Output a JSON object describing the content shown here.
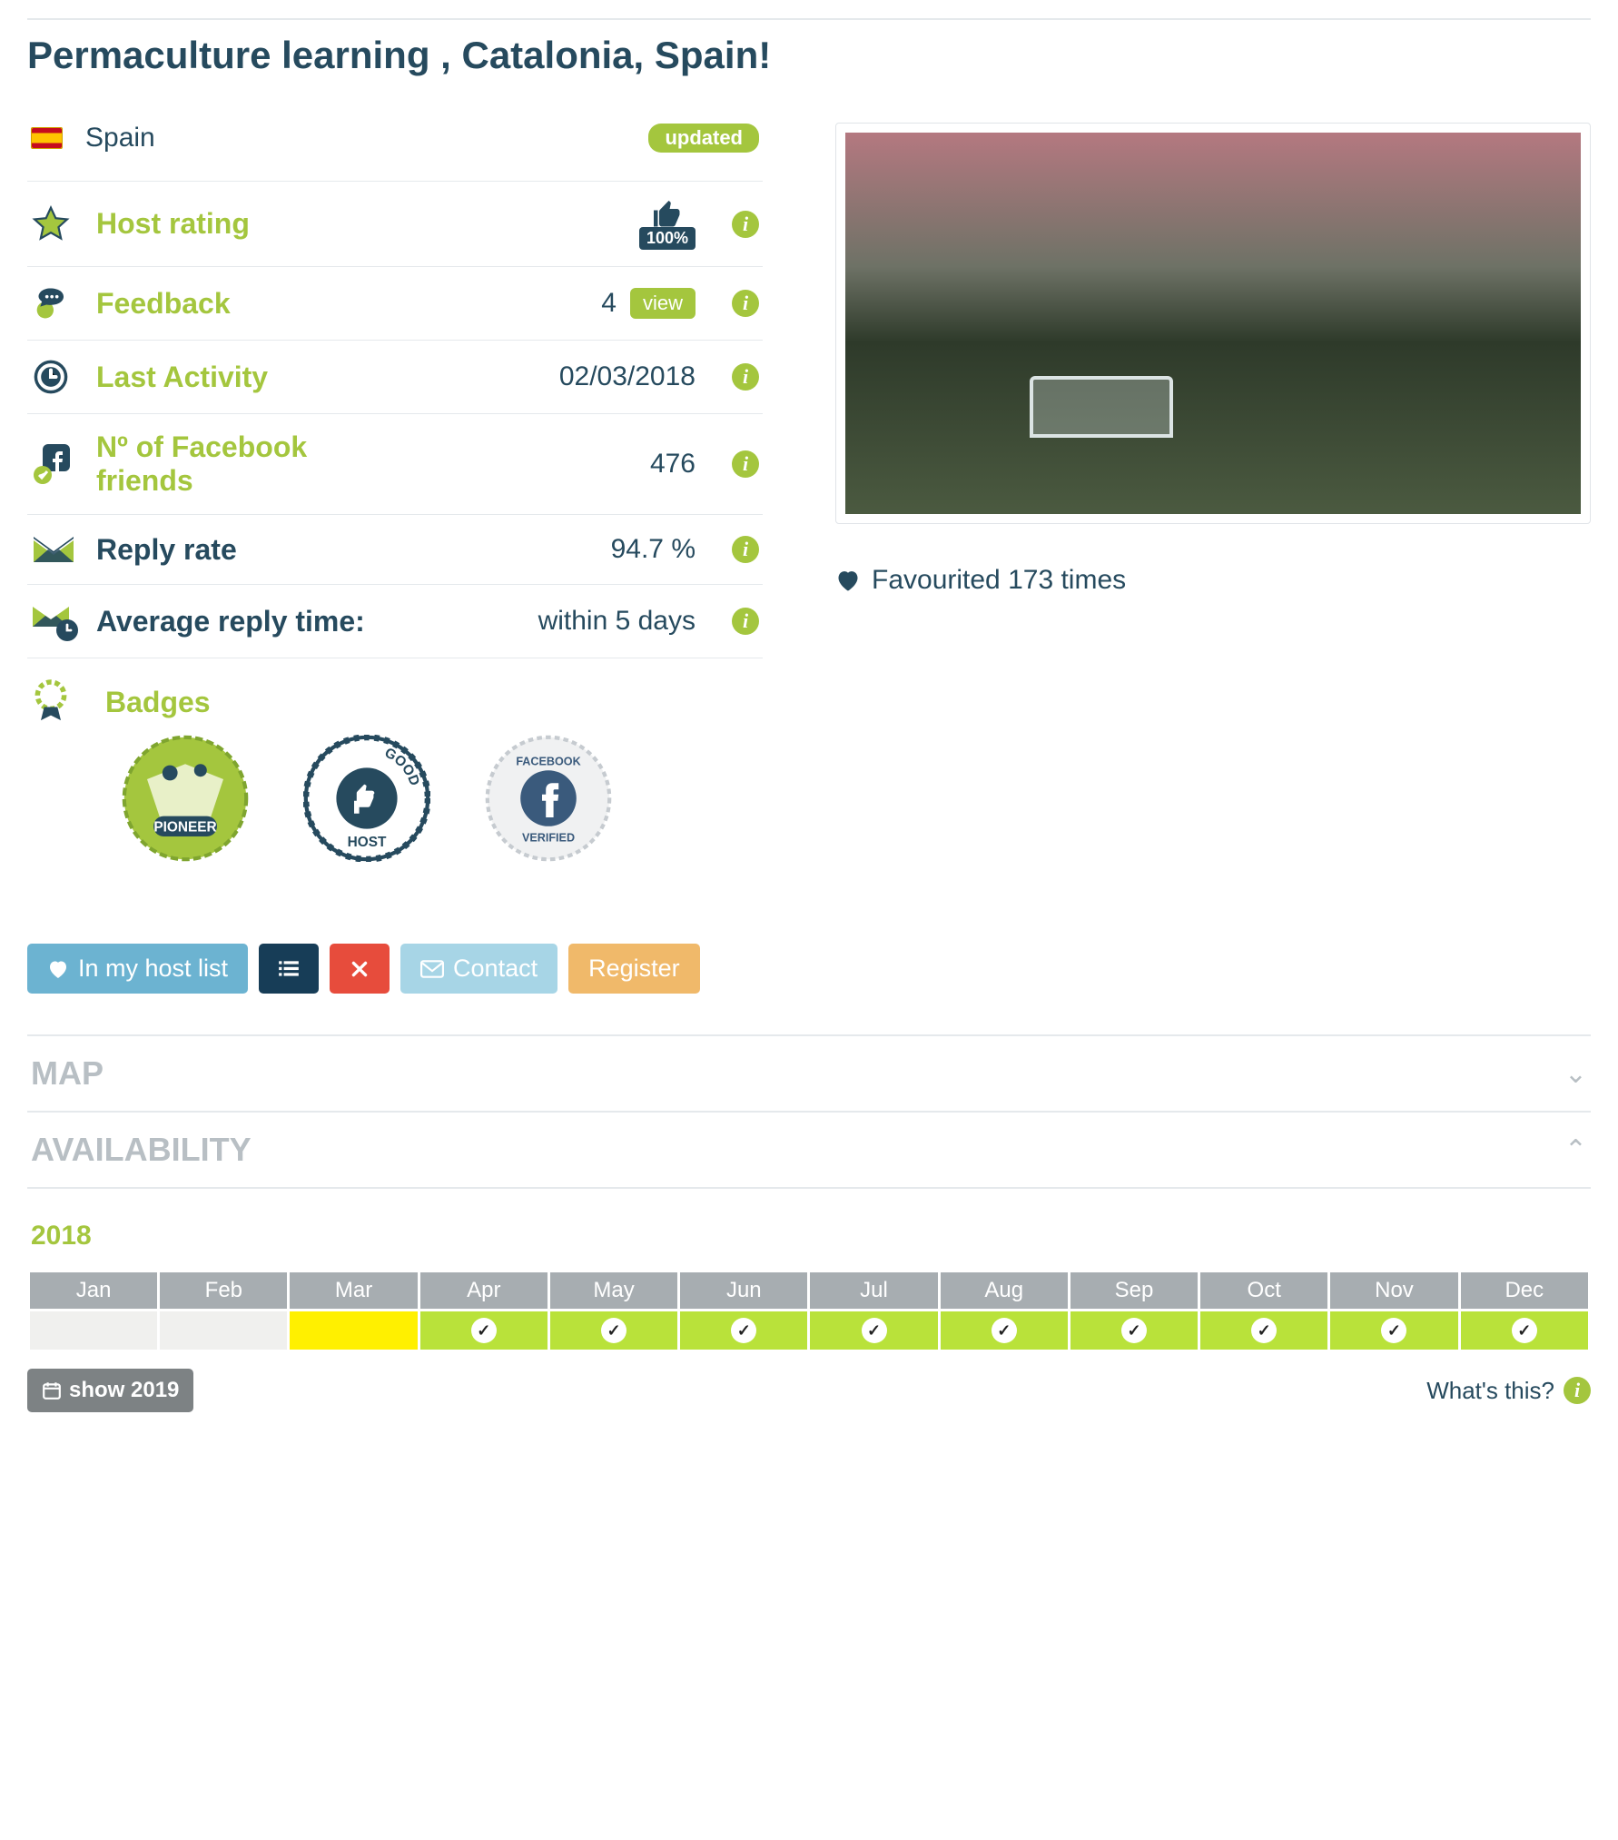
{
  "title": "Permaculture learning , Catalonia, Spain!",
  "country": "Spain",
  "updated_label": "updated",
  "stats": {
    "host_rating": {
      "label": "Host rating",
      "percent": "100%"
    },
    "feedback": {
      "label": "Feedback",
      "count": "4",
      "view": "view"
    },
    "last_activity": {
      "label": "Last Activity",
      "value": "02/03/2018"
    },
    "fb_friends": {
      "label": "Nº of Facebook friends",
      "value": "476"
    },
    "reply_rate": {
      "label": "Reply rate",
      "value": "94.7 %"
    },
    "reply_time": {
      "label": "Average reply time:",
      "value": "within 5 days"
    },
    "badges_label": "Badges"
  },
  "favourited": "Favourited 173 times",
  "buttons": {
    "host_list": "In my host list",
    "contact": "Contact",
    "register": "Register"
  },
  "accordion": {
    "map": "MAP",
    "availability": "AVAILABILITY"
  },
  "calendar": {
    "year": "2018",
    "months": [
      "Jan",
      "Feb",
      "Mar",
      "Apr",
      "May",
      "Jun",
      "Jul",
      "Aug",
      "Sep",
      "Oct",
      "Nov",
      "Dec"
    ],
    "status": [
      "empty",
      "empty",
      "yellow",
      "avail",
      "avail",
      "avail",
      "avail",
      "avail",
      "avail",
      "avail",
      "avail",
      "avail"
    ]
  },
  "show_next": "show 2019",
  "whats_this": "What's this?"
}
